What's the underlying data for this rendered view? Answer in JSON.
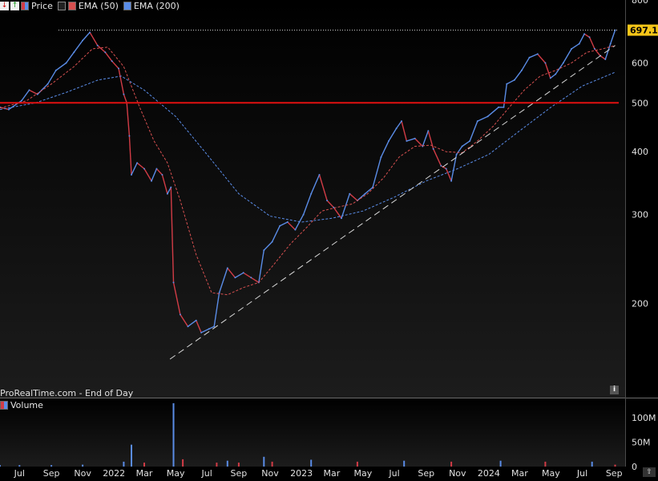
{
  "legend": {
    "items": [
      {
        "label": "Price",
        "color": "#d23c46"
      },
      {
        "label": "EMA (50)",
        "color": "#d65050"
      },
      {
        "label": "EMA (200)",
        "color": "#5a8ce6"
      }
    ]
  },
  "source_text": "ProRealTime.com - End of Day",
  "volume_legend": "Volume",
  "info_icon": "i",
  "last_price_label": "697.12",
  "chart_data": [
    {
      "type": "line",
      "title": "",
      "scale": "log",
      "ylim": [
        130,
        800
      ],
      "y_ticks": [
        800,
        600,
        500,
        400,
        300,
        200
      ],
      "y_tick_labels": [
        "800",
        "600",
        "500",
        "400",
        "300",
        "200"
      ],
      "x_ticks": [
        "2021-07",
        "2021-09",
        "2021-11",
        "2022-01",
        "2022-03",
        "2022-05",
        "2022-07",
        "2022-09",
        "2022-11",
        "2023-01",
        "2023-03",
        "2023-05",
        "2023-07",
        "2023-09",
        "2023-11",
        "2024-01",
        "2024-03",
        "2024-05",
        "2024-07",
        "2024-09"
      ],
      "x_tick_labels": [
        "Jul",
        "Sep",
        "Nov",
        "2022",
        "Mar",
        "May",
        "Jul",
        "Sep",
        "Nov",
        "2023",
        "Mar",
        "May",
        "Jul",
        "Sep",
        "Nov",
        "2024",
        "Mar",
        "May",
        "Jul",
        "Sep"
      ],
      "last_price": 697.12,
      "series": [
        {
          "name": "Price",
          "color": "#5a8ce6",
          "down_color": "#d23c46",
          "points": [
            [
              "2021-05-24",
              490
            ],
            [
              "2021-06-10",
              485
            ],
            [
              "2021-07-05",
              505
            ],
            [
              "2021-07-20",
              530
            ],
            [
              "2021-08-05",
              520
            ],
            [
              "2021-08-25",
              545
            ],
            [
              "2021-09-10",
              580
            ],
            [
              "2021-09-30",
              600
            ],
            [
              "2021-10-15",
              630
            ],
            [
              "2021-11-01",
              665
            ],
            [
              "2021-11-15",
              690
            ],
            [
              "2021-11-30",
              650
            ],
            [
              "2021-12-15",
              630
            ],
            [
              "2021-12-28",
              605
            ],
            [
              "2022-01-10",
              585
            ],
            [
              "2022-01-20",
              520
            ],
            [
              "2022-01-26",
              500
            ],
            [
              "2022-01-31",
              430
            ],
            [
              "2022-02-04",
              360
            ],
            [
              "2022-02-15",
              380
            ],
            [
              "2022-03-01",
              370
            ],
            [
              "2022-03-15",
              350
            ],
            [
              "2022-03-25",
              370
            ],
            [
              "2022-04-05",
              360
            ],
            [
              "2022-04-15",
              330
            ],
            [
              "2022-04-22",
              340
            ],
            [
              "2022-04-27",
              220
            ],
            [
              "2022-05-10",
              190
            ],
            [
              "2022-05-25",
              180
            ],
            [
              "2022-06-10",
              185
            ],
            [
              "2022-06-20",
              175
            ],
            [
              "2022-07-05",
              178
            ],
            [
              "2022-07-15",
              180
            ],
            [
              "2022-07-25",
              210
            ],
            [
              "2022-08-10",
              235
            ],
            [
              "2022-08-25",
              225
            ],
            [
              "2022-09-10",
              230
            ],
            [
              "2022-09-25",
              225
            ],
            [
              "2022-10-10",
              220
            ],
            [
              "2022-10-20",
              255
            ],
            [
              "2022-11-05",
              265
            ],
            [
              "2022-11-20",
              285
            ],
            [
              "2022-12-05",
              290
            ],
            [
              "2022-12-20",
              280
            ],
            [
              "2023-01-05",
              300
            ],
            [
              "2023-01-20",
              330
            ],
            [
              "2023-02-05",
              360
            ],
            [
              "2023-02-20",
              320
            ],
            [
              "2023-03-05",
              310
            ],
            [
              "2023-03-20",
              295
            ],
            [
              "2023-04-05",
              330
            ],
            [
              "2023-04-20",
              320
            ],
            [
              "2023-05-05",
              330
            ],
            [
              "2023-05-20",
              340
            ],
            [
              "2023-06-05",
              390
            ],
            [
              "2023-06-20",
              420
            ],
            [
              "2023-07-05",
              445
            ],
            [
              "2023-07-15",
              460
            ],
            [
              "2023-07-25",
              420
            ],
            [
              "2023-08-10",
              425
            ],
            [
              "2023-08-25",
              410
            ],
            [
              "2023-09-05",
              440
            ],
            [
              "2023-09-15",
              405
            ],
            [
              "2023-09-30",
              375
            ],
            [
              "2023-10-10",
              370
            ],
            [
              "2023-10-20",
              350
            ],
            [
              "2023-10-30",
              395
            ],
            [
              "2023-11-10",
              410
            ],
            [
              "2023-11-25",
              420
            ],
            [
              "2023-12-10",
              460
            ],
            [
              "2023-12-30",
              470
            ],
            [
              "2024-01-20",
              490
            ],
            [
              "2024-01-30",
              490
            ],
            [
              "2024-02-05",
              545
            ],
            [
              "2024-02-20",
              555
            ],
            [
              "2024-03-05",
              580
            ],
            [
              "2024-03-20",
              615
            ],
            [
              "2024-04-05",
              625
            ],
            [
              "2024-04-20",
              600
            ],
            [
              "2024-04-30",
              560
            ],
            [
              "2024-05-10",
              570
            ],
            [
              "2024-05-25",
              600
            ],
            [
              "2024-06-10",
              640
            ],
            [
              "2024-06-25",
              655
            ],
            [
              "2024-07-05",
              685
            ],
            [
              "2024-07-15",
              675
            ],
            [
              "2024-07-25",
              640
            ],
            [
              "2024-08-05",
              620
            ],
            [
              "2024-08-15",
              610
            ],
            [
              "2024-08-25",
              655
            ],
            [
              "2024-09-03",
              697
            ]
          ]
        },
        {
          "name": "EMA (50)",
          "color": "#d65050",
          "points": [
            [
              "2021-05-24",
              488
            ],
            [
              "2021-07-15",
              505
            ],
            [
              "2021-09-01",
              545
            ],
            [
              "2021-10-15",
              590
            ],
            [
              "2021-11-20",
              640
            ],
            [
              "2021-12-20",
              645
            ],
            [
              "2022-01-20",
              590
            ],
            [
              "2022-02-20",
              490
            ],
            [
              "2022-03-20",
              420
            ],
            [
              "2022-04-15",
              380
            ],
            [
              "2022-05-10",
              320
            ],
            [
              "2022-06-10",
              250
            ],
            [
              "2022-07-10",
              210
            ],
            [
              "2022-08-10",
              208
            ],
            [
              "2022-09-10",
              215
            ],
            [
              "2022-10-10",
              220
            ],
            [
              "2022-11-10",
              240
            ],
            [
              "2022-12-10",
              262
            ],
            [
              "2023-01-10",
              282
            ],
            [
              "2023-02-10",
              305
            ],
            [
              "2023-03-10",
              310
            ],
            [
              "2023-04-10",
              315
            ],
            [
              "2023-05-10",
              330
            ],
            [
              "2023-06-10",
              355
            ],
            [
              "2023-07-10",
              390
            ],
            [
              "2023-08-10",
              410
            ],
            [
              "2023-09-10",
              412
            ],
            [
              "2023-10-10",
              400
            ],
            [
              "2023-11-10",
              398
            ],
            [
              "2023-12-10",
              420
            ],
            [
              "2024-01-10",
              450
            ],
            [
              "2024-02-10",
              490
            ],
            [
              "2024-03-10",
              530
            ],
            [
              "2024-04-10",
              565
            ],
            [
              "2024-05-10",
              580
            ],
            [
              "2024-06-10",
              600
            ],
            [
              "2024-07-10",
              630
            ],
            [
              "2024-08-10",
              640
            ],
            [
              "2024-09-03",
              650
            ]
          ]
        },
        {
          "name": "EMA (200)",
          "color": "#5a8ce6",
          "points": [
            [
              "2021-05-24",
              485
            ],
            [
              "2021-08-01",
              500
            ],
            [
              "2021-10-01",
              525
            ],
            [
              "2021-12-01",
              555
            ],
            [
              "2022-01-15",
              565
            ],
            [
              "2022-03-01",
              530
            ],
            [
              "2022-05-01",
              470
            ],
            [
              "2022-07-01",
              395
            ],
            [
              "2022-09-01",
              330
            ],
            [
              "2022-11-01",
              298
            ],
            [
              "2023-01-01",
              290
            ],
            [
              "2023-03-01",
              295
            ],
            [
              "2023-05-01",
              305
            ],
            [
              "2023-07-01",
              325
            ],
            [
              "2023-09-01",
              350
            ],
            [
              "2023-11-01",
              370
            ],
            [
              "2024-01-01",
              395
            ],
            [
              "2024-03-01",
              440
            ],
            [
              "2024-05-01",
              490
            ],
            [
              "2024-07-01",
              540
            ],
            [
              "2024-09-03",
              575
            ]
          ]
        },
        {
          "name": "",
          "style": "dashed",
          "color": "#d8d8d8",
          "points": [
            [
              "2022-04-20",
              155
            ],
            [
              "2024-09-03",
              650
            ]
          ]
        },
        {
          "name": "",
          "style": "solid",
          "color": "#e01010",
          "points": [
            [
              "2021-05-24",
              500
            ],
            [
              "2024-09-10",
              500
            ]
          ]
        },
        {
          "name": "",
          "style": "dotted",
          "color": "#d8d8d8",
          "points": [
            [
              "2021-09-15",
              697.12
            ],
            [
              "2024-09-10",
              697.12
            ]
          ]
        }
      ]
    },
    {
      "type": "bar",
      "title": "",
      "ylim": [
        0,
        130
      ],
      "y_ticks": [
        0,
        50,
        100
      ],
      "y_tick_labels": [
        "0",
        "50M",
        "100M"
      ],
      "series": [
        {
          "name": "Volume",
          "color": "#5a8ce6",
          "down_color": "#d23c46",
          "points": [
            [
              "2021-05-24",
              3
            ],
            [
              "2021-07-01",
              3
            ],
            [
              "2021-09-01",
              3
            ],
            [
              "2021-11-01",
              4
            ],
            [
              "2022-01-20",
              10
            ],
            [
              "2022-02-04",
              45
            ],
            [
              "2022-03-01",
              8
            ],
            [
              "2022-04-27",
              130
            ],
            [
              "2022-05-15",
              15
            ],
            [
              "2022-07-20",
              8
            ],
            [
              "2022-08-10",
              12
            ],
            [
              "2022-09-01",
              8
            ],
            [
              "2022-10-20",
              20
            ],
            [
              "2022-11-05",
              10
            ],
            [
              "2023-01-20",
              14
            ],
            [
              "2023-04-20",
              10
            ],
            [
              "2023-07-20",
              12
            ],
            [
              "2023-10-20",
              10
            ],
            [
              "2024-01-24",
              12
            ],
            [
              "2024-04-20",
              10
            ],
            [
              "2024-07-20",
              10
            ],
            [
              "2024-09-03",
              4
            ]
          ]
        }
      ]
    }
  ]
}
